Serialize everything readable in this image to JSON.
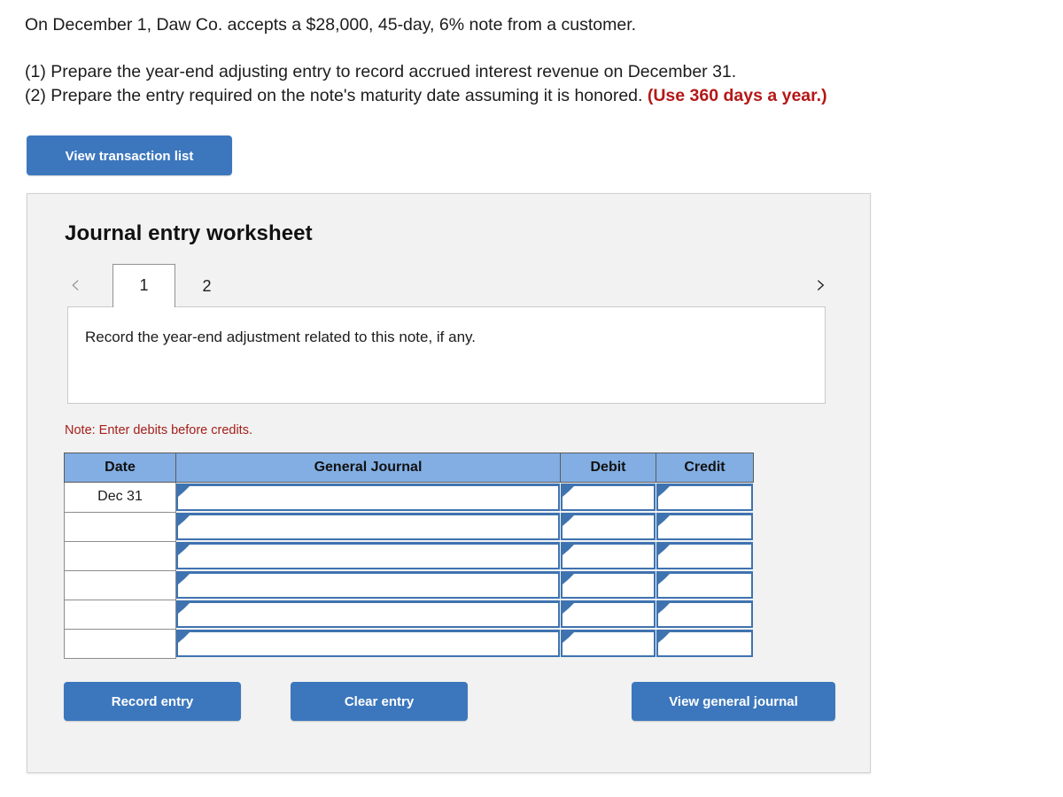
{
  "problem": {
    "statement": "On December 1, Daw Co. accepts a $28,000, 45-day, 6% note from a customer.",
    "requirement_1": "(1) Prepare the year-end adjusting entry to record accrued interest revenue on December 31.",
    "requirement_2_main": "(2) Prepare the entry required on the note's maturity date assuming it is honored.",
    "requirement_2_red": "(Use 360 days a year.)"
  },
  "toolbar": {
    "view_transaction_list_label": "View transaction list"
  },
  "worksheet": {
    "title": "Journal entry worksheet",
    "nav": {
      "prev_icon": "chevron-left-icon",
      "next_icon": "chevron-right-icon",
      "prev_enabled": false,
      "next_enabled": true
    },
    "tabs": [
      {
        "label": "1",
        "active": true
      },
      {
        "label": "2",
        "active": false
      }
    ],
    "instruction": "Record the year-end adjustment related to this note, if any.",
    "note": "Note: Enter debits before credits.",
    "table": {
      "headers": [
        "Date",
        "General Journal",
        "Debit",
        "Credit"
      ],
      "rows": [
        {
          "date": "Dec 31",
          "general_journal": "",
          "debit": "",
          "credit": ""
        },
        {
          "date": "",
          "general_journal": "",
          "debit": "",
          "credit": ""
        },
        {
          "date": "",
          "general_journal": "",
          "debit": "",
          "credit": ""
        },
        {
          "date": "",
          "general_journal": "",
          "debit": "",
          "credit": ""
        },
        {
          "date": "",
          "general_journal": "",
          "debit": "",
          "credit": ""
        },
        {
          "date": "",
          "general_journal": "",
          "debit": "",
          "credit": ""
        }
      ]
    },
    "buttons": {
      "record_entry": "Record entry",
      "clear_entry": "Clear entry",
      "view_general_journal": "View general journal"
    }
  },
  "colors": {
    "button_blue": "#3c77bd",
    "table_header_blue": "#82aee3",
    "input_border_blue": "#3f73b0",
    "note_red": "#a5201c",
    "emphasis_red": "#b51717",
    "panel_bg": "#f2f2f2"
  }
}
